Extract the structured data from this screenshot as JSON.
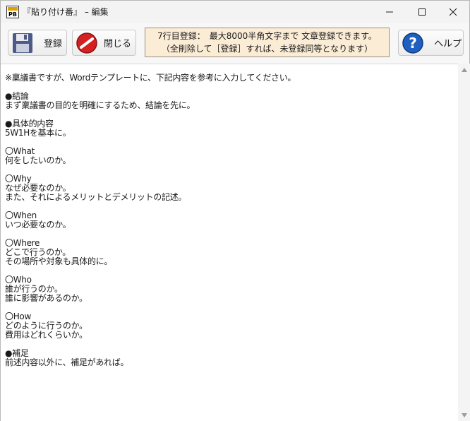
{
  "window": {
    "title": "『貼り付け番』 – 編集",
    "icon": "app-icon"
  },
  "toolbar": {
    "save_label": "登録",
    "close_label": "閉じる",
    "help_label": "ヘルプ",
    "notice_line1": "7行目登録：　最大8000半角文字まで 文章登録できます。",
    "notice_line2": "（全削除して［登録］すれば、未登録同等となります）"
  },
  "editor": {
    "lines": [
      "※稟議書ですが、Wordテンプレートに、下記内容を参考に入力してください。",
      "",
      "●結論",
      "まず稟議書の目的を明確にするため、結論を先に。",
      "",
      "●具体的内容",
      "5W1Hを基本に。",
      "",
      "〇What",
      "何をしたいのか。",
      "",
      "〇Why",
      "なぜ必要なのか。",
      "また、それによるメリットとデメリットの記述。",
      "",
      "〇When",
      "いつ必要なのか。",
      "",
      "〇Where",
      "どこで行うのか。",
      "その場所や対象も具体的に。",
      "",
      "〇Who",
      "誰が行うのか。",
      "誰に影響があるのか。",
      "",
      "〇How",
      "どのように行うのか。",
      "費用はどれくらいか。",
      "",
      "●補足",
      "前述内容以外に、補足があれば。"
    ]
  },
  "colors": {
    "notice_bg": "#fbecd6",
    "close_icon_red": "#d42020",
    "help_icon_blue": "#1f5fbf"
  }
}
